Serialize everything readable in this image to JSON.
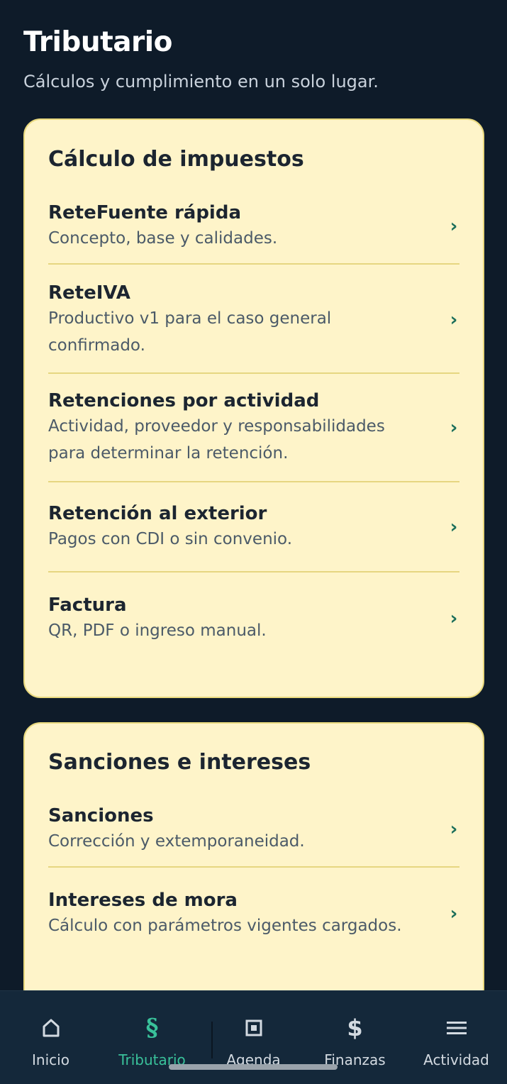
{
  "header": {
    "title": "Tributario",
    "subtitle": "Cálculos y cumplimiento en un solo lugar."
  },
  "sections": [
    {
      "title": "Cálculo de impuestos",
      "items": [
        {
          "title": "ReteFuente rápida",
          "desc": "Concepto, base y calidades."
        },
        {
          "title": "ReteIVA",
          "desc": "Productivo v1 para el caso general confirmado."
        },
        {
          "title": "Retenciones por actividad",
          "desc": "Actividad, proveedor y responsabilidades para determinar la retención."
        },
        {
          "title": "Retención al exterior",
          "desc": "Pagos con CDI o sin convenio."
        },
        {
          "title": "Factura",
          "desc": "QR, PDF o ingreso manual."
        }
      ]
    },
    {
      "title": "Sanciones e intereses",
      "items": [
        {
          "title": "Sanciones",
          "desc": "Corrección y extemporaneidad."
        },
        {
          "title": "Intereses de mora",
          "desc": "Cálculo con parámetros vigentes cargados."
        }
      ]
    }
  ],
  "chevron": "›",
  "tabbar": {
    "tabs": [
      {
        "label": "Inicio",
        "icon": "home-icon"
      },
      {
        "label": "Tributario",
        "icon": "section-sign-icon",
        "glyph": "§",
        "active": true
      },
      {
        "label": "Agenda",
        "icon": "agenda-icon"
      },
      {
        "label": "Finanzas",
        "icon": "dollar-icon",
        "glyph": "$"
      },
      {
        "label": "Actividad",
        "icon": "menu-icon"
      }
    ]
  },
  "colors": {
    "background": "#0e1b29",
    "card": "#fef4c9",
    "accent": "#39c19a",
    "chevron": "#1b6e5a",
    "tabbar": "#14283a"
  }
}
